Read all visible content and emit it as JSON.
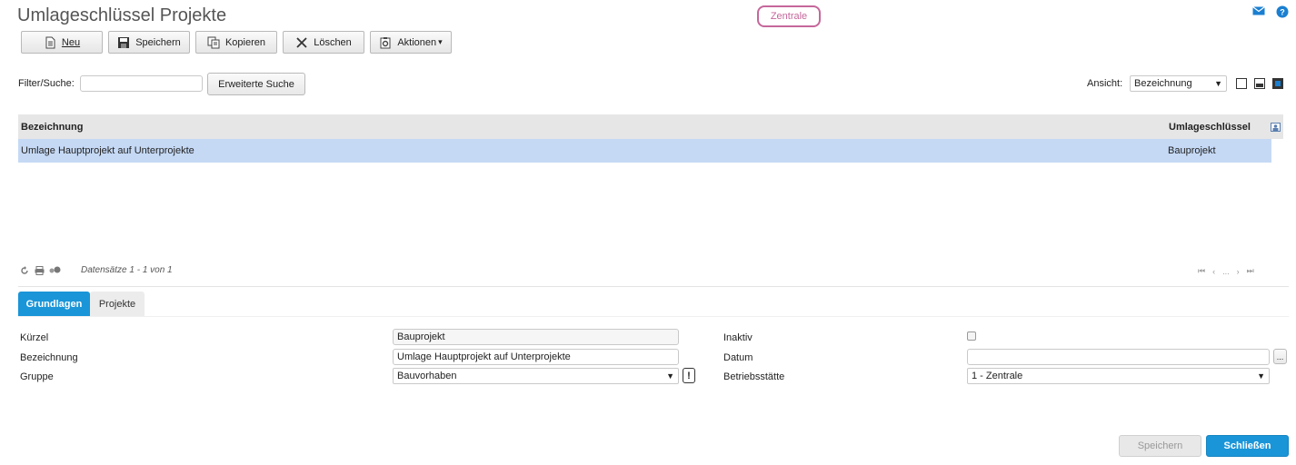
{
  "header": {
    "title": "Umlageschlüssel Projekte",
    "location_badge": "Zentrale",
    "icons": [
      "mail-icon",
      "help-icon"
    ]
  },
  "toolbar": {
    "new_label": "Neu",
    "save_label": "Speichern",
    "copy_label": "Kopieren",
    "delete_label": "Löschen",
    "actions_label": "Aktionen"
  },
  "filter": {
    "label": "Filter/Suche:",
    "value": "",
    "advanced_label": "Erweiterte Suche"
  },
  "view": {
    "label": "Ansicht:",
    "selected": "Bezeichnung"
  },
  "grid": {
    "columns": [
      "Bezeichnung",
      "Umlageschlüssel"
    ],
    "rows": [
      {
        "bezeichnung": "Umlage Hauptprojekt auf Unterprojekte",
        "umlageschluessel": "Bauprojekt"
      }
    ]
  },
  "status": {
    "records_text": "Datensätze 1 - 1 von 1",
    "pager_ellipsis": "..."
  },
  "tabs": [
    {
      "label": "Grundlagen",
      "active": true
    },
    {
      "label": "Projekte",
      "active": false
    }
  ],
  "form": {
    "kuerzel_label": "Kürzel",
    "kuerzel_value": "Bauprojekt",
    "bezeichnung_label": "Bezeichnung",
    "bezeichnung_value": "Umlage Hauptprojekt auf Unterprojekte",
    "gruppe_label": "Gruppe",
    "gruppe_value": "Bauvorhaben",
    "gruppe_alert": "!",
    "inaktiv_label": "Inaktiv",
    "inaktiv_checked": false,
    "datum_label": "Datum",
    "datum_value": "",
    "datum_button": "...",
    "betriebsstaette_label": "Betriebsstätte",
    "betriebsstaette_value": "1 - Zentrale"
  },
  "footer": {
    "save_label": "Speichern",
    "close_label": "Schließen"
  },
  "colors": {
    "accent": "#1a95d8",
    "badge": "#c5679b",
    "selected_row": "#c5d9f5"
  }
}
